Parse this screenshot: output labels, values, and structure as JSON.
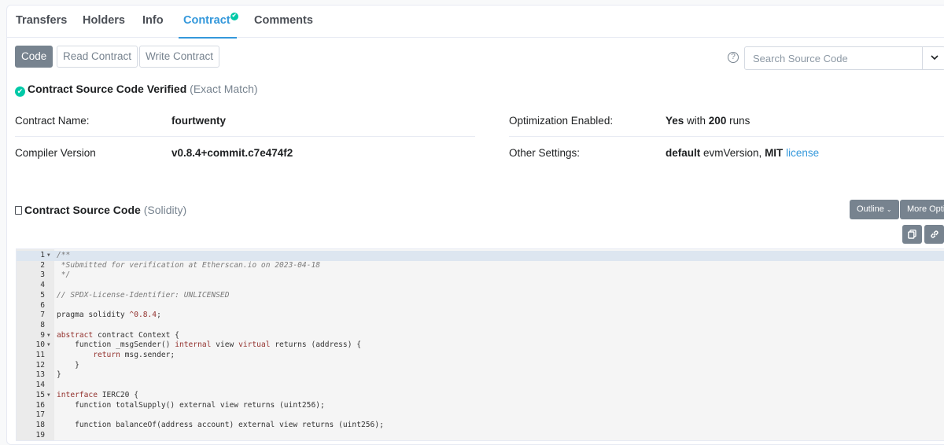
{
  "tabs": [
    {
      "label": "Transfers"
    },
    {
      "label": "Holders"
    },
    {
      "label": "Info"
    },
    {
      "label": "Contract",
      "active": true
    },
    {
      "label": "Comments"
    }
  ],
  "toolbar": {
    "code": "Code",
    "read": "Read Contract",
    "write": "Write Contract"
  },
  "search": {
    "placeholder": "Search Source Code",
    "help": "?"
  },
  "verified": {
    "title": "Contract Source Code Verified",
    "match": "(Exact Match)"
  },
  "details": {
    "contract_name_label": "Contract Name:",
    "contract_name": "fourtwenty",
    "compiler_label": "Compiler Version",
    "compiler": "v0.8.4+commit.c7e474f2",
    "optimization_label": "Optimization Enabled:",
    "optimization_yes": "Yes",
    "optimization_with": " with ",
    "optimization_runs": "200",
    "optimization_runs_suffix": " runs",
    "settings_label": "Other Settings:",
    "settings_default": "default",
    "settings_evm": " evmVersion, ",
    "settings_mit": "MIT",
    "settings_license": "license"
  },
  "source": {
    "title": "Contract Source Code",
    "lang": "(Solidity)",
    "outline": "Outline",
    "more": "More Options"
  },
  "code_lines": [
    {
      "n": "1",
      "fold": true,
      "text": "/**",
      "type": "comment"
    },
    {
      "n": "2",
      "text": " *Submitted for verification at Etherscan.io on 2023-04-18",
      "type": "comment"
    },
    {
      "n": "3",
      "text": " */",
      "type": "comment"
    },
    {
      "n": "4",
      "text": ""
    },
    {
      "n": "5",
      "text": "// SPDX-License-Identifier: UNLICENSED",
      "type": "comment"
    },
    {
      "n": "6",
      "text": ""
    },
    {
      "n": "7",
      "text": "pragma solidity ^0.8.4;"
    },
    {
      "n": "8",
      "text": ""
    },
    {
      "n": "9",
      "fold": true,
      "text": "abstract contract Context {"
    },
    {
      "n": "10",
      "fold": true,
      "text": "    function _msgSender() internal view virtual returns (address) {"
    },
    {
      "n": "11",
      "text": "        return msg.sender;"
    },
    {
      "n": "12",
      "text": "    }"
    },
    {
      "n": "13",
      "text": "}"
    },
    {
      "n": "14",
      "text": ""
    },
    {
      "n": "15",
      "fold": true,
      "text": "interface IERC20 {"
    },
    {
      "n": "16",
      "text": "    function totalSupply() external view returns (uint256);"
    },
    {
      "n": "17",
      "text": ""
    },
    {
      "n": "18",
      "text": "    function balanceOf(address account) external view returns (uint256);"
    },
    {
      "n": "19",
      "text": ""
    }
  ],
  "colors": {
    "accent": "#3498db",
    "verified": "#00c9a7",
    "button": "#77838f"
  }
}
